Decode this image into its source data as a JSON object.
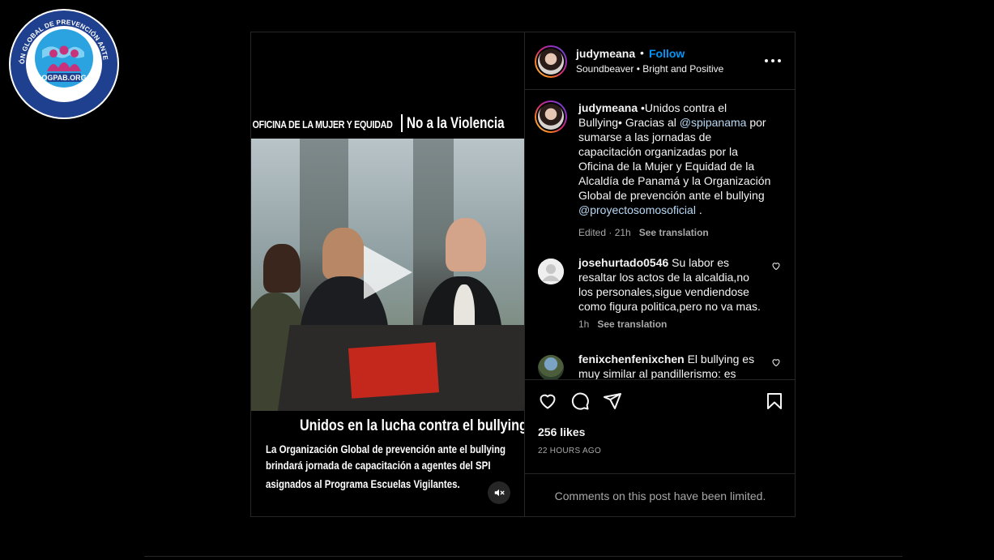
{
  "logo": {
    "ring_text": "ORGANIZACIÓN GLOBAL DE PREVENCIÓN ANTE EL BULLYING",
    "bottom_text": "SALVAMOS VIDAS",
    "center_text": "OGPAB.ORG",
    "colors": {
      "ring": "#1f3f8f",
      "globe": "#2aa3e0",
      "figures": "#c8327a"
    }
  },
  "media": {
    "top_left_caption": "OFICINA DE LA MUJER Y EQUIDAD",
    "top_right_caption": "No a la Violencia",
    "banner_title": "Unidos en la lucha contra el bullying",
    "banner_line1": "La Organización Global de prevención ante el bullying",
    "banner_line2": "brindará jornada de capacitación a agentes del SPI",
    "banner_line3": "asignados al Programa Escuelas Vigilantes.",
    "play_icon": "play-icon",
    "mute_icon": "muted-speaker-icon"
  },
  "header": {
    "username": "judymeana",
    "dot": "•",
    "follow": "Follow",
    "audio": "Soundbeaver • Bright and Positive"
  },
  "caption": {
    "username": "judymeana",
    "text_a": " •Unidos contra el Bullying• Gracias al ",
    "mention1": "@spipanama",
    "text_b": " por sumarse a las jornadas de capacitación organizadas por la Oficina de la Mujer y Equidad de la Alcaldía de Panamá y la Organización Global de prevención ante el bullying ",
    "mention2": "@proyectosomosoficial",
    "text_c": " .",
    "edited": "Edited · 21h",
    "translate": "See translation"
  },
  "comments": [
    {
      "username": "josehurtado0546",
      "text": " Su labor es resaltar los actos de la alcaldia,no los personales,sigue vendiendose como figura politica,pero no va mas.",
      "time": "1h",
      "translate": "See translation"
    },
    {
      "username": "fenixchenfenixchen",
      "text": " El bullying es muy similar al pandillerismo: es"
    }
  ],
  "actions": {
    "likes": "256 likes",
    "time": "22 HOURS AGO",
    "limited": "Comments on this post have been limited."
  },
  "colors": {
    "accent": "#0095f6",
    "border": "#262626",
    "muted": "#a8a8a8"
  }
}
